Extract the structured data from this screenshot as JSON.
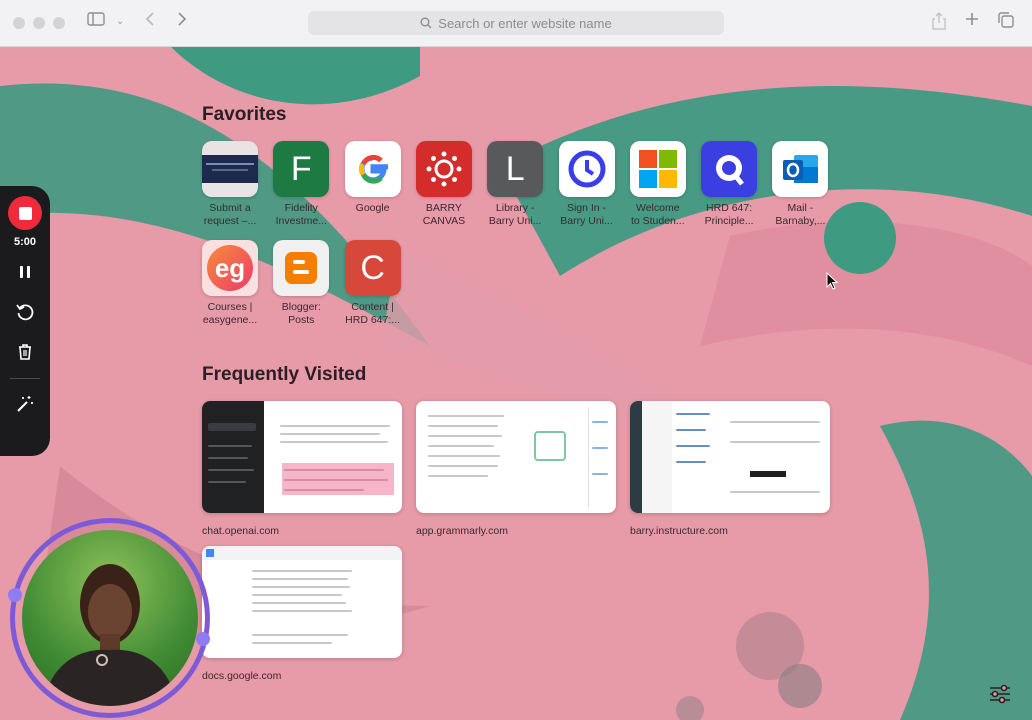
{
  "toolbar": {
    "search_placeholder": "Search or enter website name"
  },
  "favorites": {
    "title": "Favorites",
    "items": [
      {
        "label": "Submit a\nrequest –...",
        "glyph": "",
        "bg": "#1d2a4d",
        "icon": "submit-request-thumbnail-icon"
      },
      {
        "label": "Fidelity\nInvestme...",
        "glyph": "F",
        "bg": "#1e7a43",
        "icon": "fidelity-letter-icon"
      },
      {
        "label": "Google",
        "glyph": "",
        "bg": "#ffffff",
        "icon": "google-logo-icon"
      },
      {
        "label": "BARRY\nCANVAS",
        "glyph": "",
        "bg": "#d42b2b",
        "icon": "canvas-logo-icon"
      },
      {
        "label": "Library -\nBarry Uni...",
        "glyph": "L",
        "bg": "#58595b",
        "icon": "library-letter-icon"
      },
      {
        "label": "Sign In -\nBarry Uni...",
        "glyph": "",
        "bg": "#ffffff",
        "icon": "okta-logo-icon"
      },
      {
        "label": "Welcome\nto Studen...",
        "glyph": "",
        "bg": "#ffffff",
        "icon": "microsoft-logo-icon"
      },
      {
        "label": "HRD 647:\nPrinciple...",
        "glyph": "",
        "bg": "#3b3ee0",
        "icon": "q-logo-icon"
      },
      {
        "label": "Mail -\nBarnaby,...",
        "glyph": "",
        "bg": "#ffffff",
        "icon": "outlook-logo-icon"
      },
      {
        "label": "Courses |\neasygene...",
        "glyph": "eg",
        "bg": "#f14d4d",
        "icon": "easygenerator-logo-icon"
      },
      {
        "label": "Blogger:\nPosts",
        "glyph": "",
        "bg": "#f0f0f0",
        "icon": "blogger-logo-icon"
      },
      {
        "label": "Content |\nHRD 647:...",
        "glyph": "C",
        "bg": "#d7483b",
        "icon": "content-letter-icon"
      }
    ]
  },
  "frequent": {
    "title": "Frequently Visited",
    "items": [
      {
        "label": "chat.openai.com"
      },
      {
        "label": "app.grammarly.com"
      },
      {
        "label": "barry.instructure.com"
      },
      {
        "label": "docs.google.com"
      }
    ]
  },
  "recorder": {
    "timer": "5:00"
  },
  "colors": {
    "background": "#e79aa7",
    "leaf": "#3f9a82",
    "record": "#ef2a3b",
    "ring": "#7d5bd6"
  }
}
